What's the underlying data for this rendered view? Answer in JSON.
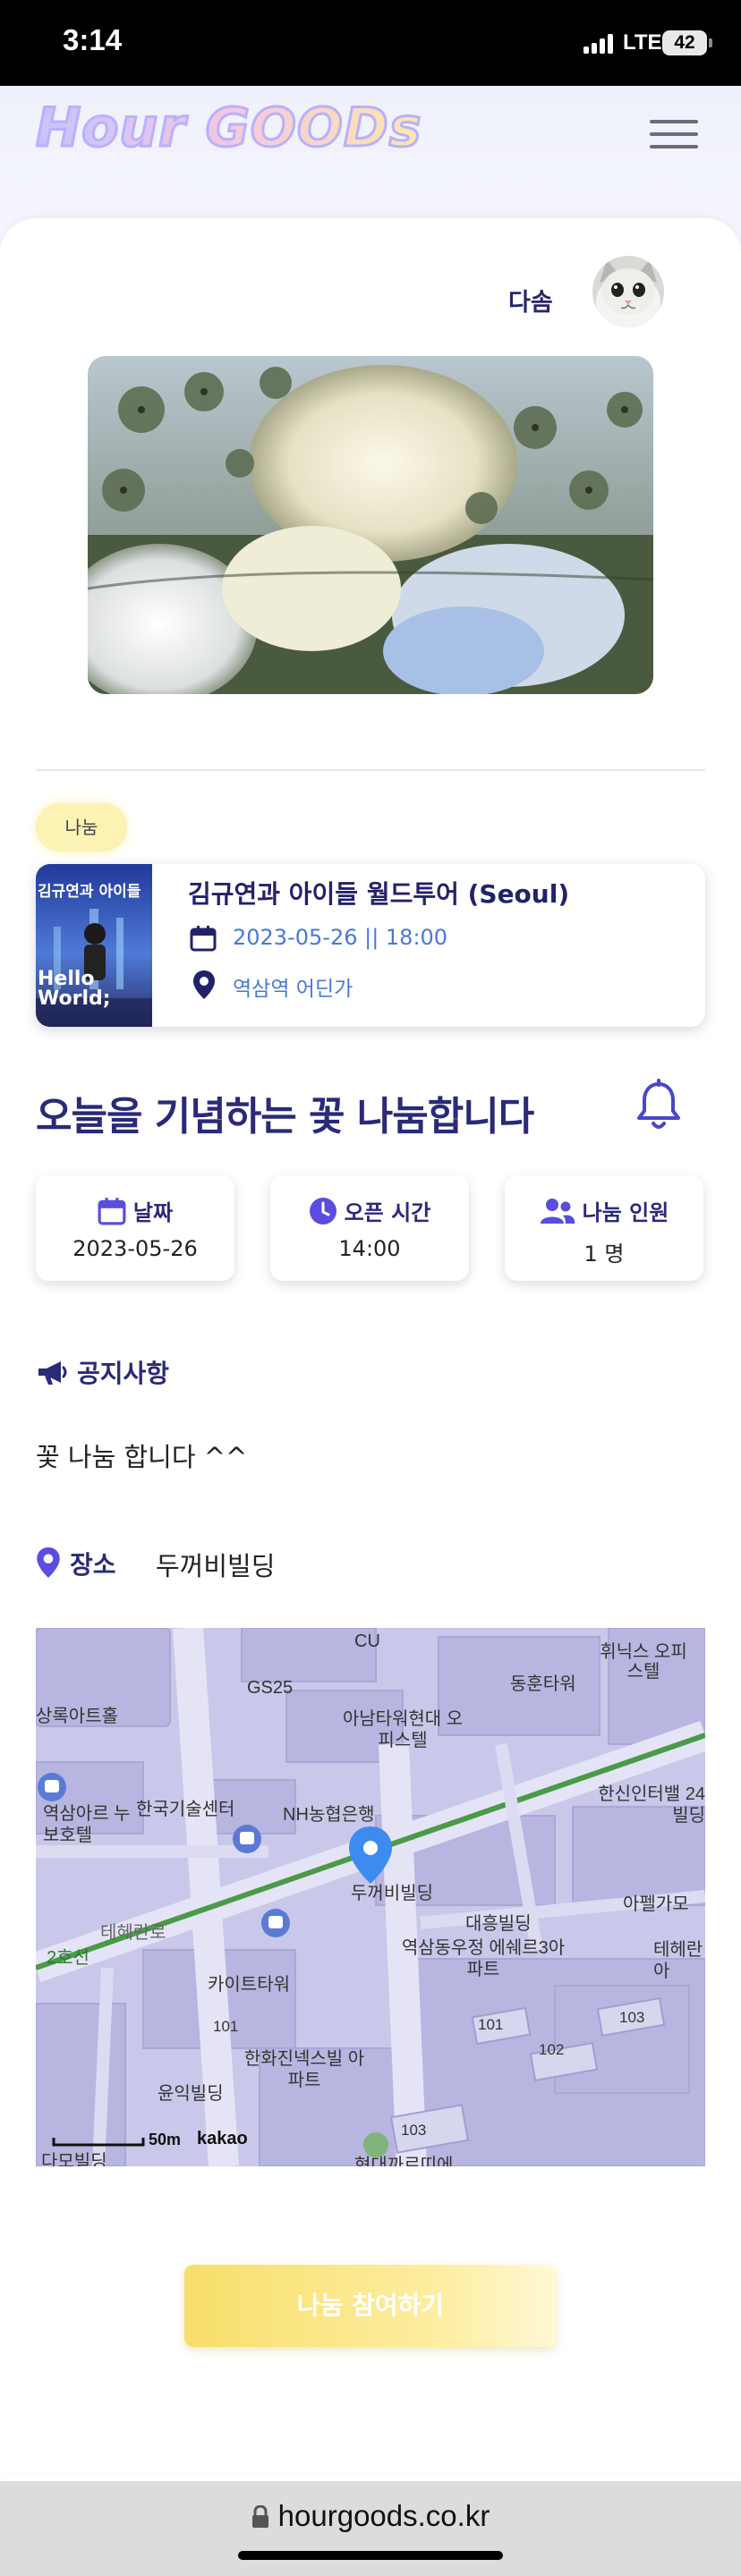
{
  "status_bar": {
    "time": "3:14",
    "network": "LTE",
    "battery": "42"
  },
  "header": {
    "logo_text": "Hour GOODs"
  },
  "author": {
    "name": "다솜"
  },
  "post": {
    "category_badge": "나눔",
    "title": "오늘을 기념하는 꽃 나눔합니다"
  },
  "event": {
    "thumb_title": "김규연과 아이들",
    "thumb_caption": "Hello World;",
    "title": "김규연과 아이들 월드투어 (Seoul)",
    "datetime": "2023-05-26 || 18:00",
    "location": "역삼역 어딘가"
  },
  "info": {
    "date_label": "날짜",
    "date_value": "2023-05-26",
    "time_label": "오픈 시간",
    "time_value": "14:00",
    "people_label": "나눔 인원",
    "people_value": "1 명"
  },
  "notice": {
    "heading": "공지사항",
    "body": "꽃 나눔 합니다 ^^"
  },
  "place": {
    "heading": "장소",
    "value": "두꺼비빌딩"
  },
  "map": {
    "labels": [
      "CU",
      "휘닉스 오피스텔",
      "GS25",
      "동훈타워",
      "상록아트홀",
      "아남타워현대 오피스텔",
      "한국기술센터",
      "NH농협은행",
      "한신인터밸 24빌딩",
      "역삼아르 누보호텔",
      "두꺼비빌딩",
      "아펠가모",
      "2호선",
      "테헤란로",
      "대흥빌딩",
      "역삼동우정 에쉐르3아파트",
      "테헤란 아",
      "카이트타워",
      "101",
      "102",
      "103",
      "한화진넥스빌 아파트",
      "윤익빌딩",
      "다모빌딩",
      "현대까르띠에"
    ],
    "scale": "50m",
    "brand": "kakao"
  },
  "actions": {
    "join_label": "나눔 참여하기"
  },
  "browser": {
    "url": "hourgoods.co.kr"
  },
  "colors": {
    "primary": "#2a2a78",
    "accent_blue": "#4a78d8",
    "badge_yellow": "#fbf2b3",
    "button_yellow": "#f8de6a",
    "map_bg": "#c7c6ea"
  }
}
